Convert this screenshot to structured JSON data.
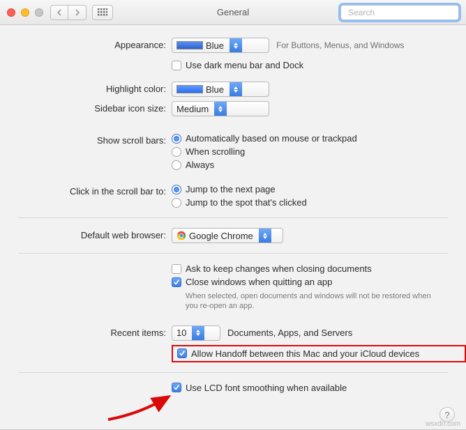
{
  "titlebar": {
    "title": "General",
    "search_placeholder": "Search"
  },
  "labels": {
    "appearance": "Appearance:",
    "highlight": "Highlight color:",
    "sidebar": "Sidebar icon size:",
    "scrollbars": "Show scroll bars:",
    "clickscroll": "Click in the scroll bar to:",
    "browser": "Default web browser:",
    "recent": "Recent items:"
  },
  "appearance": {
    "value": "Blue",
    "desc": "For Buttons, Menus, and Windows",
    "darkbar": "Use dark menu bar and Dock"
  },
  "highlight": {
    "value": "Blue"
  },
  "sidebar": {
    "value": "Medium"
  },
  "scroll": {
    "opt1": "Automatically based on mouse or trackpad",
    "opt2": "When scrolling",
    "opt3": "Always"
  },
  "clickscroll": {
    "opt1": "Jump to the next page",
    "opt2": "Jump to the spot that's clicked"
  },
  "browser": {
    "value": "Google Chrome"
  },
  "closing": {
    "ask": "Ask to keep changes when closing documents",
    "close": "Close windows when quitting an app",
    "note": "When selected, open documents and windows will not be restored when you re-open an app."
  },
  "recent": {
    "value": "10",
    "desc": "Documents, Apps, and Servers"
  },
  "handoff": "Allow Handoff between this Mac and your iCloud devices",
  "lcd": "Use LCD font smoothing when available",
  "watermark": "wsxdn.com"
}
